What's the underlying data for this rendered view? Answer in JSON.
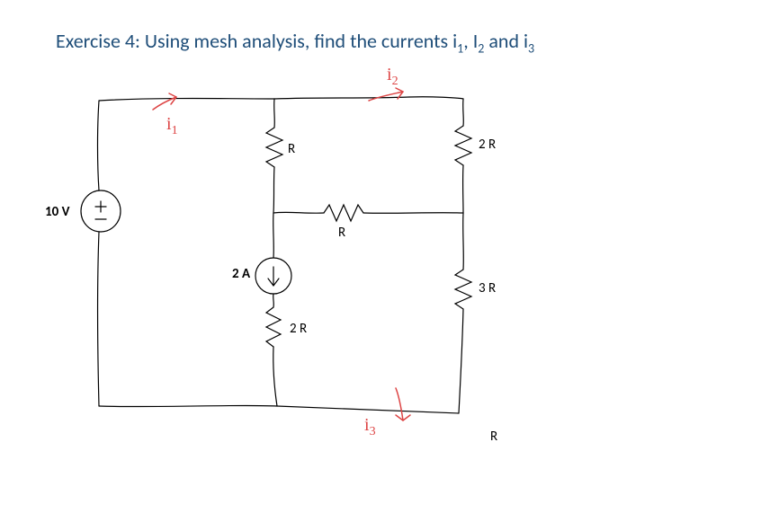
{
  "title_pre": "Exercise 4: Using mesh analysis, find the currents i",
  "title_sub1": "1",
  "title_mid1": ", I",
  "title_sub2": "2",
  "title_mid2": " and i",
  "title_sub3": "3",
  "voltage": "10 V",
  "current_src": "2 A",
  "r_top_mid": "R",
  "r_mid": "R",
  "r_topright": "2 R",
  "r_botmid": "2 R",
  "r_right": "3 R",
  "r_corner": "R",
  "i1": "i",
  "i1s": "1",
  "i2": "i",
  "i2s": "2",
  "i3": "i",
  "i3s": "3",
  "chart_data": {
    "type": "circuit_diagram",
    "method": "mesh analysis",
    "unknowns": [
      "i1",
      "i2",
      "i3"
    ],
    "sources": [
      {
        "type": "voltage",
        "value": "10 V",
        "location": "left branch"
      },
      {
        "type": "current",
        "value": "2 A",
        "direction": "down",
        "location": "middle-left branch"
      }
    ],
    "resistors": [
      {
        "value": "R",
        "location": "upper middle vertical"
      },
      {
        "value": "R",
        "location": "middle horizontal"
      },
      {
        "value": "2R",
        "location": "upper right vertical"
      },
      {
        "value": "2R",
        "location": "lower middle vertical"
      },
      {
        "value": "3R",
        "location": "lower right vertical"
      },
      {
        "value": "R",
        "location": "bottom right"
      }
    ],
    "meshes": [
      {
        "name": "i1",
        "loop": "top-left"
      },
      {
        "name": "i2",
        "loop": "top-right"
      },
      {
        "name": "i3",
        "loop": "bottom"
      }
    ]
  }
}
